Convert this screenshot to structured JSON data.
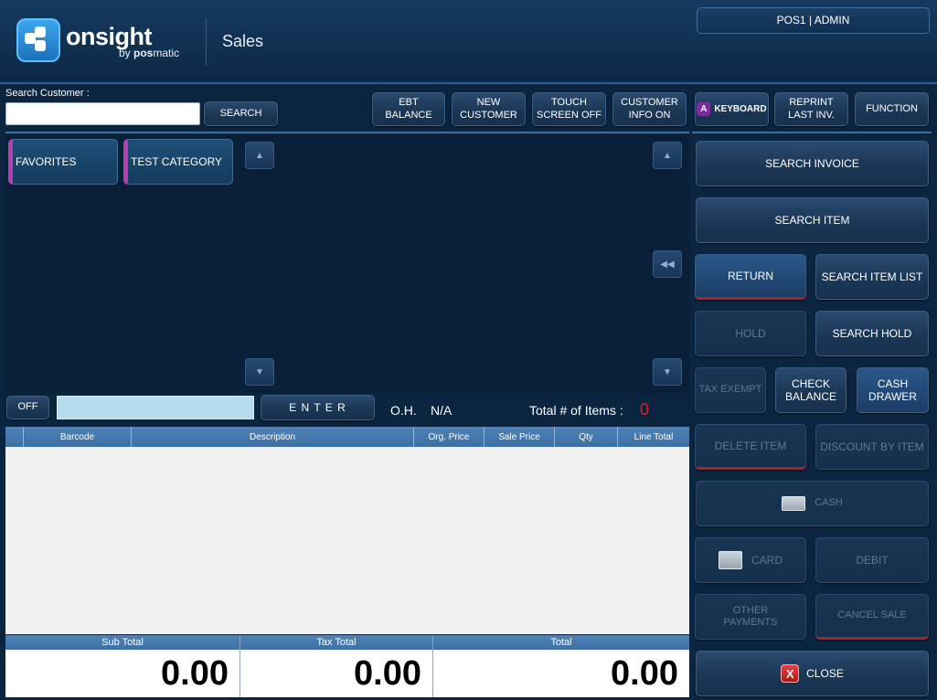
{
  "header": {
    "brand": "onsight",
    "brand_sub_prefix": "by ",
    "brand_sub_bold": "pos",
    "brand_sub_suffix": "matic",
    "page_title": "Sales",
    "user_badge": "POS1 | ADMIN"
  },
  "search": {
    "label": "Search Customer :",
    "value": "",
    "button": "SEARCH"
  },
  "toolbar": {
    "ebt_balance": [
      "EBT",
      "BALANCE"
    ],
    "new_customer": [
      "NEW",
      "CUSTOMER"
    ],
    "touch_screen_off": [
      "TOUCH",
      "SCREEN OFF"
    ],
    "customer_info_on": [
      "CUSTOMER",
      "INFO ON"
    ],
    "keyboard_icon": "A",
    "keyboard": "KEYBOARD",
    "reprint_last_inv": [
      "REPRINT",
      "LAST INV."
    ],
    "function": "FUNCTION"
  },
  "categories": [
    {
      "label": "FAVORITES"
    },
    {
      "label": "TEST CATEGORY"
    }
  ],
  "entry": {
    "toggle": "OFF",
    "barcode_value": "",
    "enter": "E N T E R",
    "oh_label": "O.H.",
    "oh_value": "N/A",
    "items_label": "Total # of Items :",
    "items_value": "0"
  },
  "table": {
    "columns": [
      "",
      "Barcode",
      "Description",
      "Org. Price",
      "Sale Price",
      "Qty",
      "Line Total"
    ],
    "rows": []
  },
  "totals": {
    "sub_total_label": "Sub Total",
    "sub_total": "0.00",
    "tax_total_label": "Tax Total",
    "tax_total": "0.00",
    "total_label": "Total",
    "total": "0.00"
  },
  "actions": {
    "search_invoice": "SEARCH INVOICE",
    "search_item": "SEARCH  ITEM",
    "return": "RETURN",
    "search_item_list": "SEARCH ITEM LIST",
    "hold": "HOLD",
    "search_hold": "SEARCH HOLD",
    "tax_exempt": "TAX EXEMPT",
    "check_balance": [
      "CHECK",
      "BALANCE"
    ],
    "cash_drawer": [
      "CASH",
      "DRAWER"
    ],
    "delete_item": "DELETE ITEM",
    "discount_by_item": "DISCOUNT BY ITEM",
    "cash": "CASH",
    "card": "CARD",
    "debit": "DEBIT",
    "other_payments": [
      "OTHER",
      "PAYMENTS"
    ],
    "cancel_sale": "CANCEL SALE",
    "close_icon": "X",
    "close": "CLOSE"
  },
  "colors": {
    "accent_red": "#a9222a",
    "category_accent": "#b43fb3",
    "items_count": "#e02020"
  }
}
